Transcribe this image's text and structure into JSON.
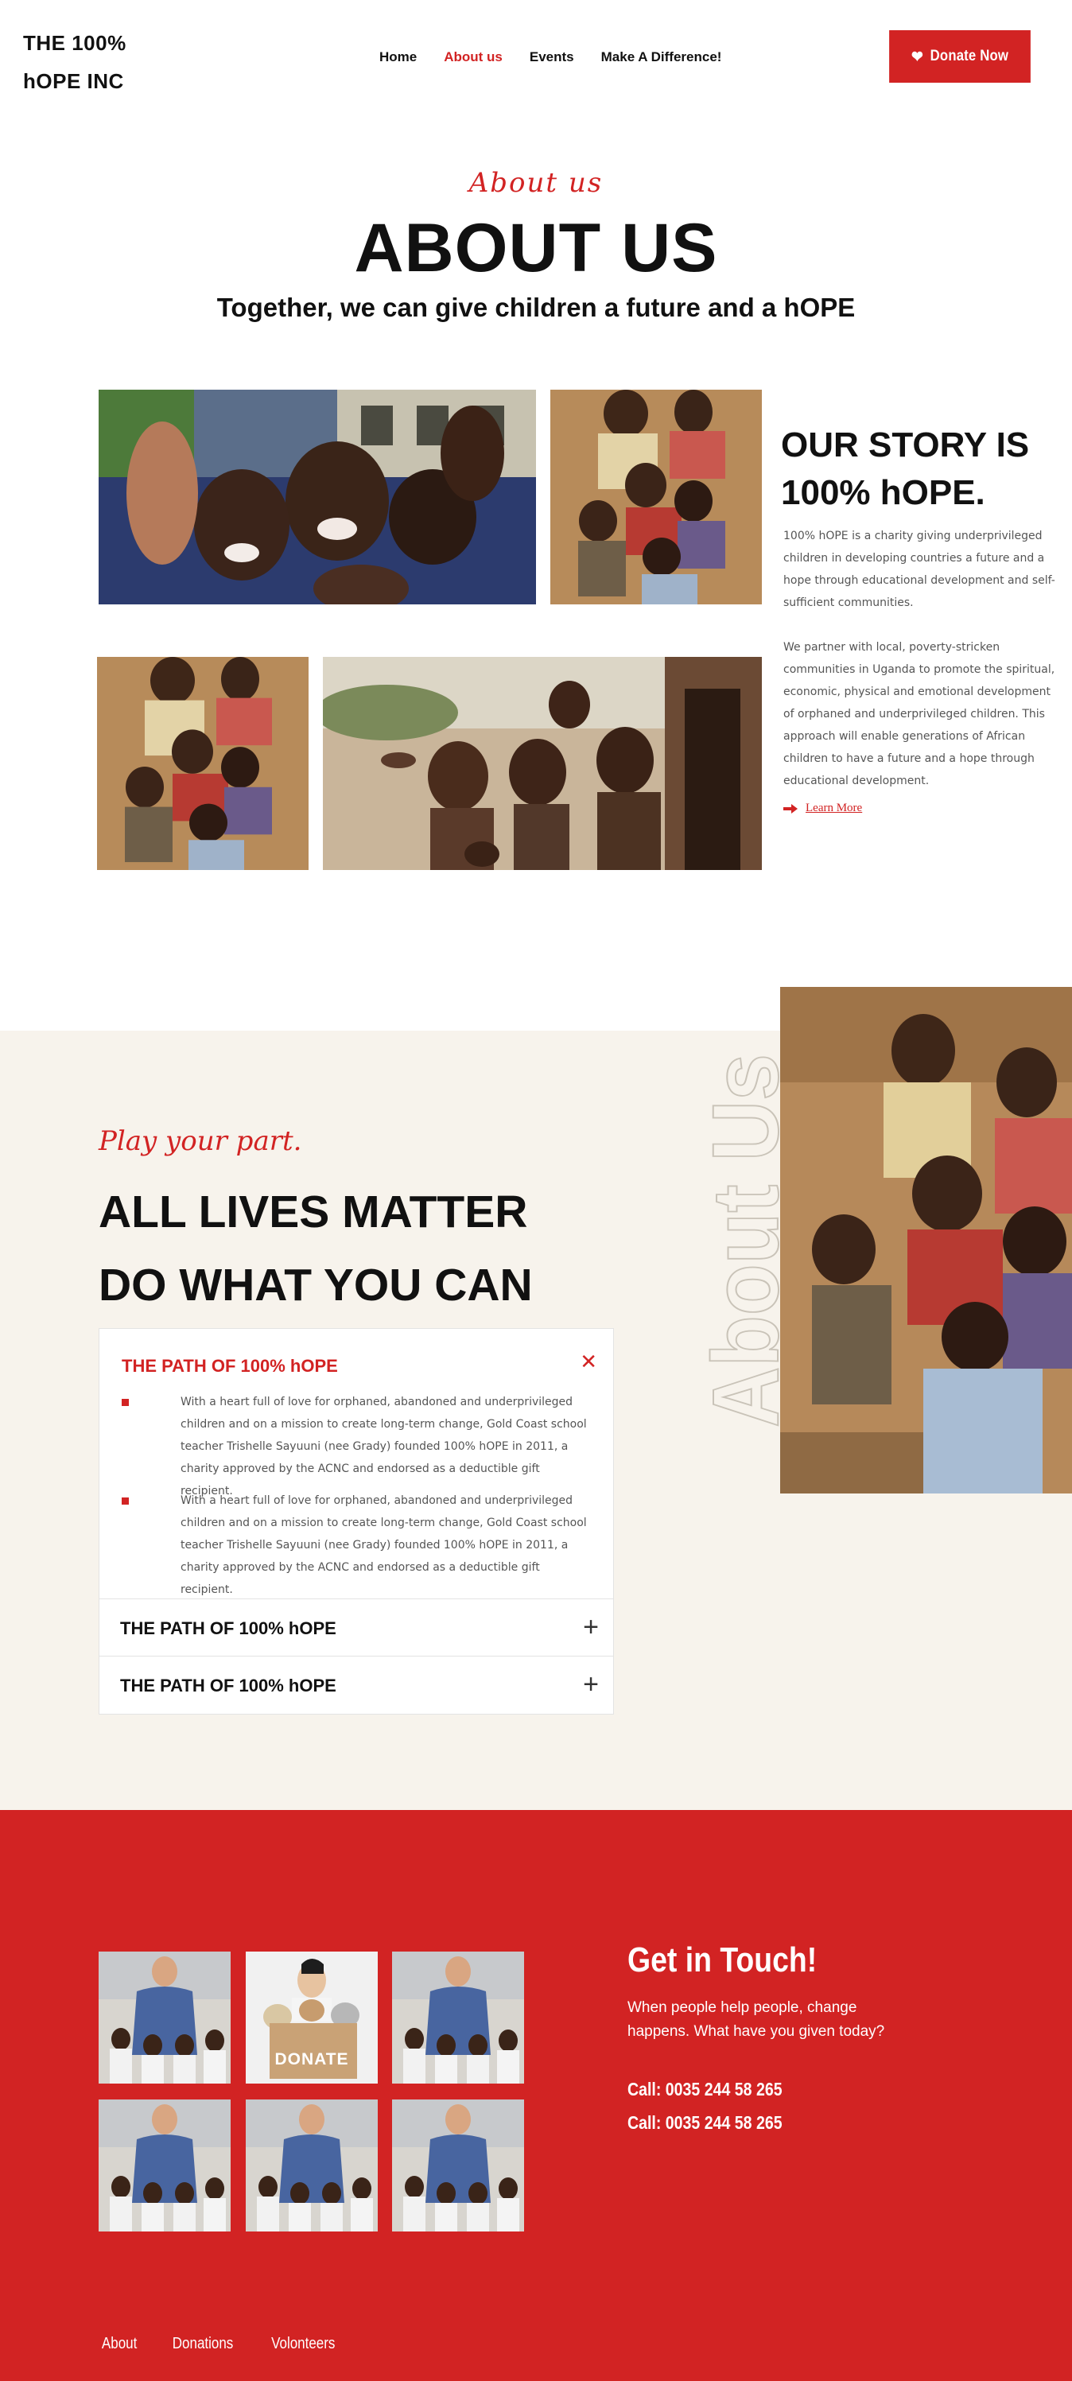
{
  "header": {
    "logo_line1": "THE 100%",
    "logo_line2": "hOPE INC",
    "nav": [
      {
        "label": "Home",
        "active": false
      },
      {
        "label": "About us",
        "active": true
      },
      {
        "label": "Events",
        "active": false
      },
      {
        "label": "Make A Difference!",
        "active": false
      }
    ],
    "donate_label": "Donate Now",
    "donate_icon": "heart-icon"
  },
  "hero": {
    "script": "About us",
    "title": "ABOUT US",
    "subtitle": "Together, we can give children a future and a hOPE"
  },
  "story": {
    "title_line1": "OUR STORY IS",
    "title_line2": "100% hOPE.",
    "paragraph1": "100% hOPE is a charity giving underprivileged children in developing countries a future and a hope through educational development and self-sufficient communities.",
    "paragraph2": "We partner with local, poverty-stricken communities in Uganda to promote the spiritual, economic, physical and emotional development of orphaned and underprivileged children. This approach will enable generations of African children to have a future and a hope through educational development.",
    "learn_more": "Learn More",
    "learn_more_icon": "arrow-right-icon"
  },
  "play": {
    "script": "Play your part.",
    "title_line1": "ALL LIVES MATTER",
    "title_line2": "DO WHAT YOU CAN",
    "watermark": "About Us"
  },
  "accordion": {
    "open_title": "THE PATH OF 100% hOPE",
    "items": [
      "With a heart full of love for orphaned, abandoned and underprivileged children and on a mission to create long-term change, Gold Coast school teacher Trishelle Sayuuni (nee Grady) founded 100% hOPE in 2011, a charity approved by the ACNC and endorsed as a deductible gift recipient.",
      "With a heart full of love for orphaned, abandoned and underprivileged children and on a mission to create long-term change, Gold Coast school teacher Trishelle Sayuuni (nee Grady) founded 100% hOPE in 2011, a charity approved by the ACNC and endorsed as a deductible gift recipient."
    ],
    "collapsed": [
      "THE PATH OF 100% hOPE",
      "THE PATH OF 100% hOPE"
    ]
  },
  "contact": {
    "title": "Get in Touch!",
    "text": "When people help people, change happens. What have you given today?",
    "call1": "Call: 0035 244 58 265",
    "call2": "Call: 0035 244 58 265",
    "donate_box_label": "DONATE"
  },
  "footer": {
    "links": [
      "About",
      "Donations",
      "Volonteers"
    ]
  },
  "colors": {
    "accent": "#d22323",
    "cream": "#f7f3ec"
  }
}
